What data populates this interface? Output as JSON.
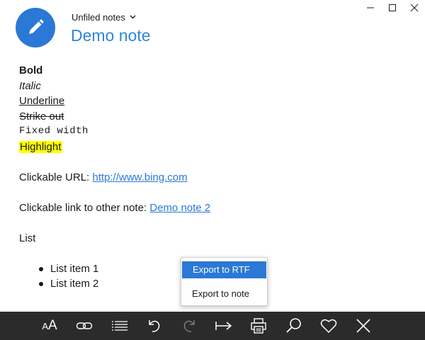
{
  "window": {
    "controls": [
      {
        "name": "minimize-icon"
      },
      {
        "name": "maximize-icon"
      },
      {
        "name": "close-icon"
      }
    ]
  },
  "header": {
    "avatar_icon": "pencil-icon",
    "accent_color": "#2b78d6",
    "notebook_label": "Unfiled notes",
    "title": "Demo note"
  },
  "note": {
    "bold": "Bold",
    "italic": "Italic",
    "underline": "Underline",
    "strikeout": "Strike out",
    "fixed_width": "Fixed width",
    "highlight": "Highlight",
    "url_label": "Clickable URL: ",
    "url": "http://www.bing.com",
    "note_link_label": "Clickable link to other note: ",
    "note_link": "Demo note 2",
    "list_heading": "List",
    "list_items": [
      "List item 1",
      "List item 2"
    ]
  },
  "context_menu": {
    "items": [
      {
        "label": "Export to RTF",
        "active": true
      },
      {
        "label": "Export to note",
        "active": false
      }
    ]
  },
  "toolbar": {
    "background": "#2b2b2b",
    "font_size_label_small": "A",
    "font_size_label_big": "A",
    "buttons": [
      "font-size-icon",
      "link-icon",
      "list-icon",
      "undo-icon",
      "redo-icon",
      "indent-icon",
      "print-icon",
      "search-icon",
      "favorite-icon",
      "close-icon"
    ]
  }
}
